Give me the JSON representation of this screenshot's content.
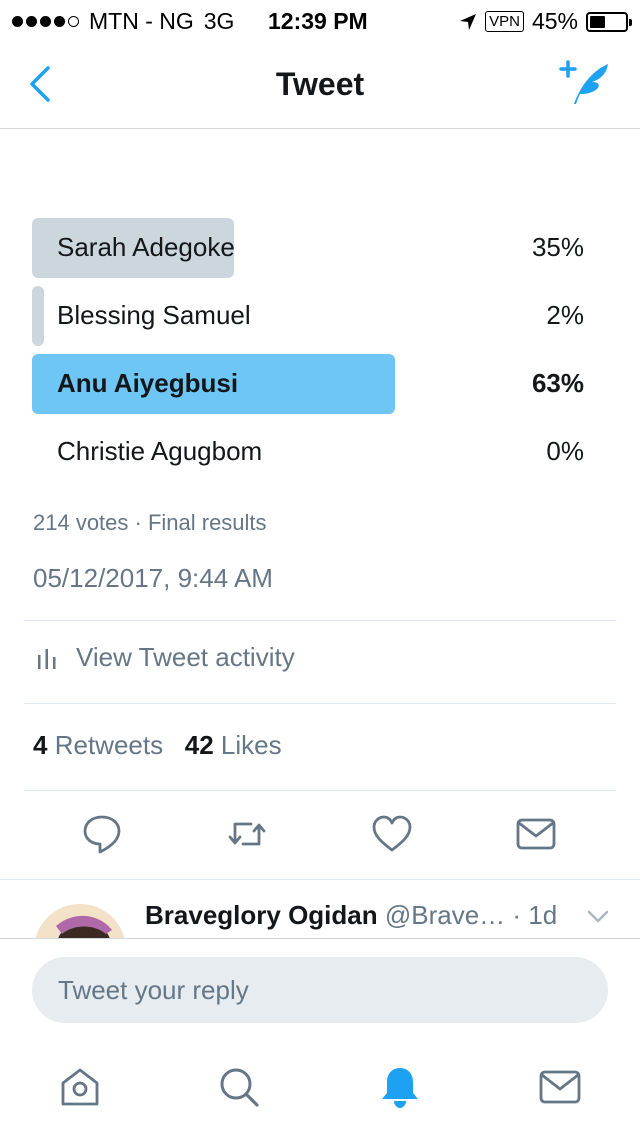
{
  "status_bar": {
    "carrier": "MTN - NG",
    "network": "3G",
    "time": "12:39 PM",
    "vpn": "VPN",
    "battery": "45%",
    "battery_level": 0.45,
    "signal_strength": 4
  },
  "header": {
    "title": "Tweet",
    "back_icon": "chevron-left-icon",
    "compose_icon": "compose-tweet-icon"
  },
  "poll": {
    "options": [
      {
        "label": "Sarah Adegoke",
        "percent": "35%",
        "share": 0.35,
        "winner": false
      },
      {
        "label": "Blessing Samuel",
        "percent": "2%",
        "share": 0.02,
        "winner": false
      },
      {
        "label": "Anu Aiyegbusi",
        "percent": "63%",
        "share": 0.63,
        "winner": true
      },
      {
        "label": "Christie Agugbom",
        "percent": "0%",
        "share": 0.0,
        "winner": false
      }
    ],
    "meta": "214 votes · Final results"
  },
  "tweet": {
    "timestamp": "05/12/2017, 9:44 AM",
    "activity_label": "View Tweet activity",
    "retweets_count": "4",
    "retweets_label": "Retweets",
    "likes_count": "42",
    "likes_label": "Likes"
  },
  "actions": {
    "icons": [
      "reply-icon",
      "retweet-icon",
      "like-icon",
      "direct-message-icon"
    ]
  },
  "reply": {
    "name": "Braveglory Ogidan",
    "handle": "@Brave…",
    "time": "· 1d"
  },
  "composer": {
    "placeholder": "Tweet your reply"
  },
  "tab_bar": {
    "icons": [
      "home-icon",
      "search-icon",
      "notifications-icon",
      "messages-icon"
    ],
    "active": "notifications-icon"
  },
  "colors": {
    "accent": "#1da1f2",
    "winner_bar": "#6ec6f5",
    "loser_bar": "#ccd6dd",
    "secondary_text": "#657786"
  }
}
